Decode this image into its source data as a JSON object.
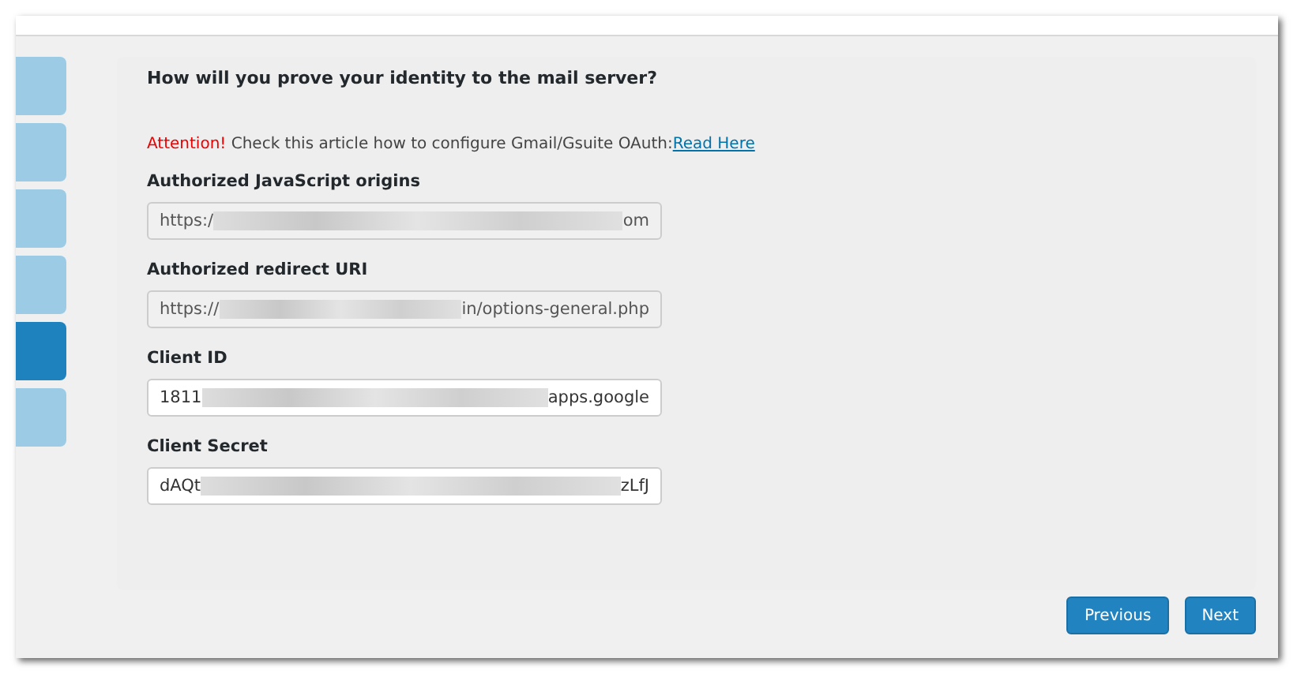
{
  "steps": [
    {
      "selected": false
    },
    {
      "selected": false
    },
    {
      "selected": false
    },
    {
      "selected": false
    },
    {
      "selected": true
    },
    {
      "selected": false
    }
  ],
  "heading": "How will you prove your identity to the mail server?",
  "notice": {
    "alert": "Attention!",
    "text": "Check this article how to configure Gmail/Gsuite OAuth:",
    "link": "Read Here"
  },
  "fields": [
    {
      "label": "Authorized JavaScript origins",
      "value_start": "https:/",
      "value_end": "om",
      "redacted": true,
      "disabled": true
    },
    {
      "label": "Authorized redirect URI",
      "value_start": "https://",
      "value_end": "in/options-general.php",
      "redacted": true,
      "disabled": true
    },
    {
      "label": "Client ID",
      "value_start": "1811",
      "value_end": "apps.google",
      "redacted": true,
      "disabled": false
    },
    {
      "label": "Client Secret",
      "value_start": "dAQt",
      "value_end": "zLfJ",
      "redacted": true,
      "disabled": false
    }
  ],
  "buttons": [
    {
      "label": "Previous"
    },
    {
      "label": "Next"
    }
  ]
}
